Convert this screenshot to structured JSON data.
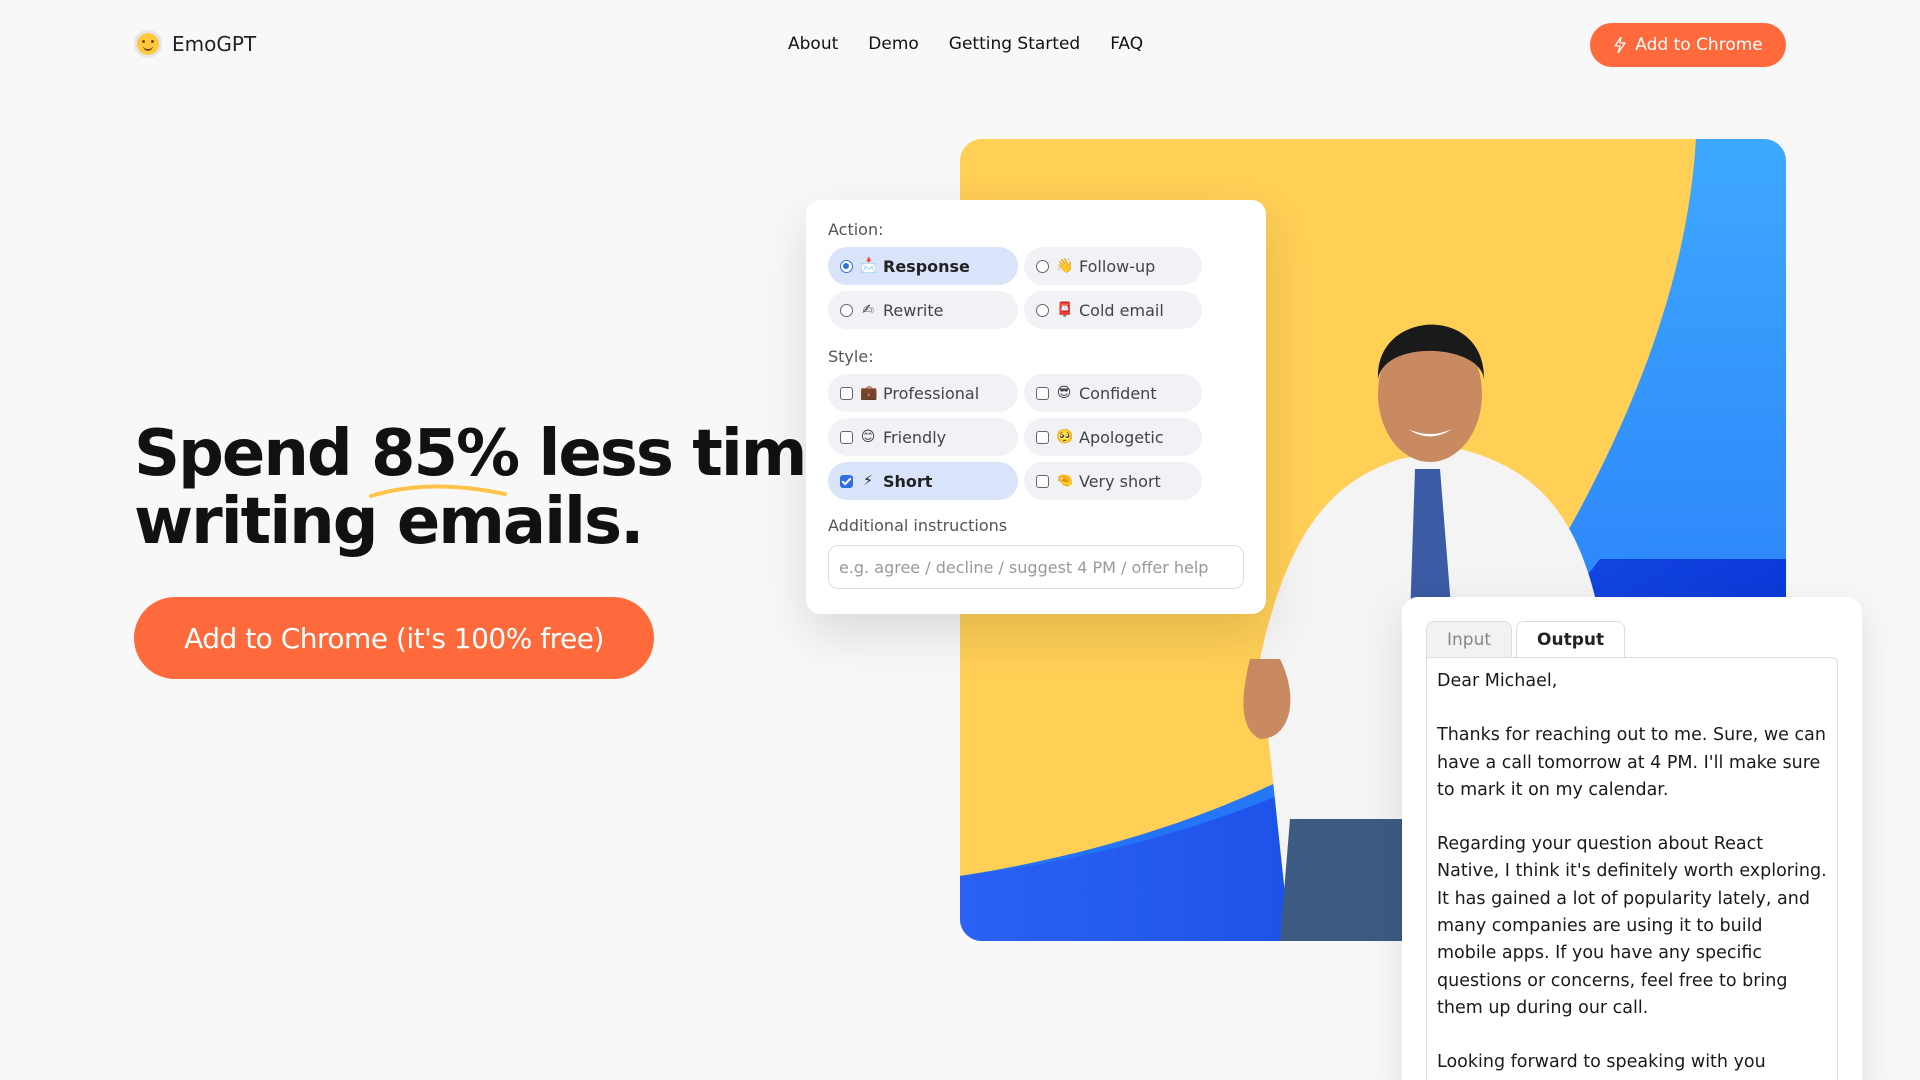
{
  "brand": {
    "name": "EmoGPT",
    "logo_icon": "smile-emoji-icon"
  },
  "nav": {
    "items": [
      "About",
      "Demo",
      "Getting Started",
      "FAQ"
    ]
  },
  "header_cta": {
    "label": "Add to Chrome",
    "icon": "bolt-icon"
  },
  "hero": {
    "title_pre": "Spend ",
    "title_highlight": "85%",
    "title_post": " less time",
    "title_line2": "writing emails.",
    "cta_label": "Add to Chrome (it's 100% free)"
  },
  "colors": {
    "accent": "#ff6a3d",
    "yellow": "#ffcf56",
    "blue": "#1f5bf2",
    "selected": "#d9e4fa"
  },
  "options_card": {
    "action_label": "Action:",
    "actions": [
      {
        "emoji": "📩",
        "label": "Response",
        "selected": true
      },
      {
        "emoji": "👋",
        "label": "Follow-up",
        "selected": false
      },
      {
        "emoji": "✍",
        "label": "Rewrite",
        "selected": false
      },
      {
        "emoji": "📮",
        "label": "Cold email",
        "selected": false
      }
    ],
    "style_label": "Style:",
    "styles": [
      {
        "emoji": "💼",
        "label": "Professional",
        "checked": false
      },
      {
        "emoji": "😎",
        "label": "Confident",
        "checked": false
      },
      {
        "emoji": "😊",
        "label": "Friendly",
        "checked": false
      },
      {
        "emoji": "🥺",
        "label": "Apologetic",
        "checked": false
      },
      {
        "emoji": "⚡",
        "label": "Short",
        "checked": true
      },
      {
        "emoji": "🤏",
        "label": "Very short",
        "checked": false
      }
    ],
    "additional_label": "Additional instructions",
    "additional_placeholder": "e.g. agree / decline / suggest 4 PM / offer help"
  },
  "output_card": {
    "tabs": [
      "Input",
      "Output"
    ],
    "active_tab": "Output",
    "greeting": "Dear Michael,",
    "p1": "Thanks for reaching out to me. Sure, we can have a call tomorrow at 4 PM. I'll make sure to mark it on my calendar.",
    "p2": "Regarding your question about React Native, I think it's definitely worth exploring. It has gained a lot of popularity lately, and many companies are using it to build mobile apps. If you have any specific questions or concerns, feel free to bring them up during our call.",
    "p3": "Looking forward to speaking with you tomorrow."
  }
}
